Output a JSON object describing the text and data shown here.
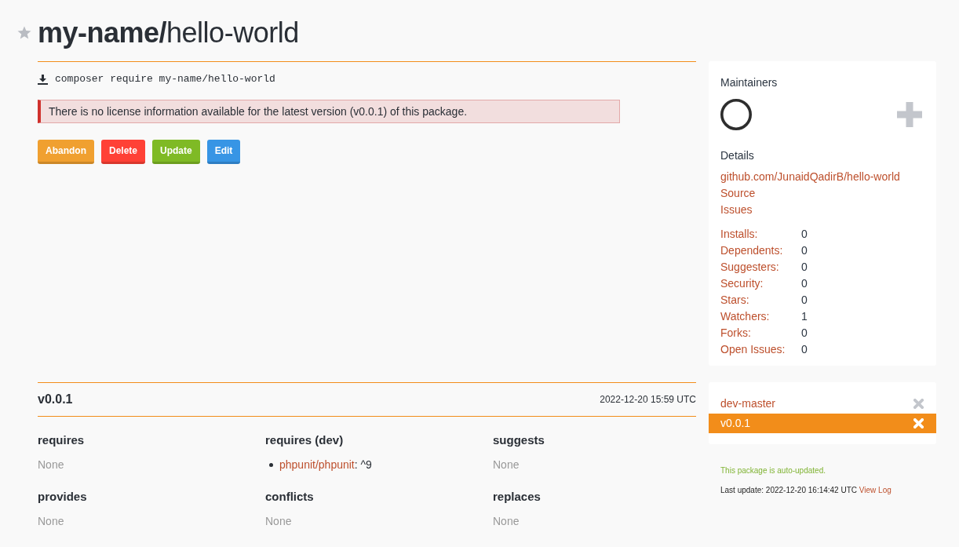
{
  "package": {
    "title": "**my-name/**hello-world",
    "starred": false,
    "install_command": "composer require my-name/hello-world"
  },
  "alert": {
    "text": "There is no license information available for the latest version (v0.0.1) of this package."
  },
  "actions": [
    {
      "label": "Abandon",
      "color": "#f0a030"
    },
    {
      "label": "Delete",
      "color": "#ff4136"
    },
    {
      "label": "Update",
      "color": "#7fba25"
    },
    {
      "label": "Edit",
      "color": "#3795e5"
    }
  ],
  "sidebar": {
    "maintainers_title": "Maintainers",
    "details_title": "Details",
    "links": [
      "github.com/JunaidQadirB/hello-world",
      "Source",
      "Issues"
    ],
    "stats": [
      {
        "label": "Installs:",
        "value": "0"
      },
      {
        "label": "Dependents:",
        "value": "0"
      },
      {
        "label": "Suggesters:",
        "value": "0"
      },
      {
        "label": "Security:",
        "value": "0"
      },
      {
        "label": "Stars:",
        "value": "0"
      },
      {
        "label": "Watchers:",
        "value": "1"
      },
      {
        "label": "Forks:",
        "value": "0"
      },
      {
        "label": "Open Issues:",
        "value": "0"
      }
    ]
  },
  "version_detail": {
    "version": "v0.0.1",
    "date": "2022-12-20 15:59 UTC",
    "sections": [
      {
        "title": "requires",
        "kind": "empty",
        "text": "None"
      },
      {
        "title": "requires (dev)",
        "kind": "list",
        "items": [
          {
            "name": "phpunit/phpunit",
            "suffix": ": ^9"
          }
        ]
      },
      {
        "title": "suggests",
        "kind": "empty",
        "text": "None"
      },
      {
        "title": "provides",
        "kind": "empty",
        "text": "None"
      },
      {
        "title": "conflicts",
        "kind": "empty",
        "text": "None"
      },
      {
        "title": "replaces",
        "kind": "empty",
        "text": "None"
      }
    ]
  },
  "versions": [
    {
      "label": "dev-master",
      "selected": false
    },
    {
      "label": "v0.0.1",
      "selected": true
    }
  ],
  "auto_update_note": "This package is auto-updated.",
  "last_update": {
    "text": "Last update: 2022-12-20 16:14:42 UTC",
    "link": "View Log"
  }
}
